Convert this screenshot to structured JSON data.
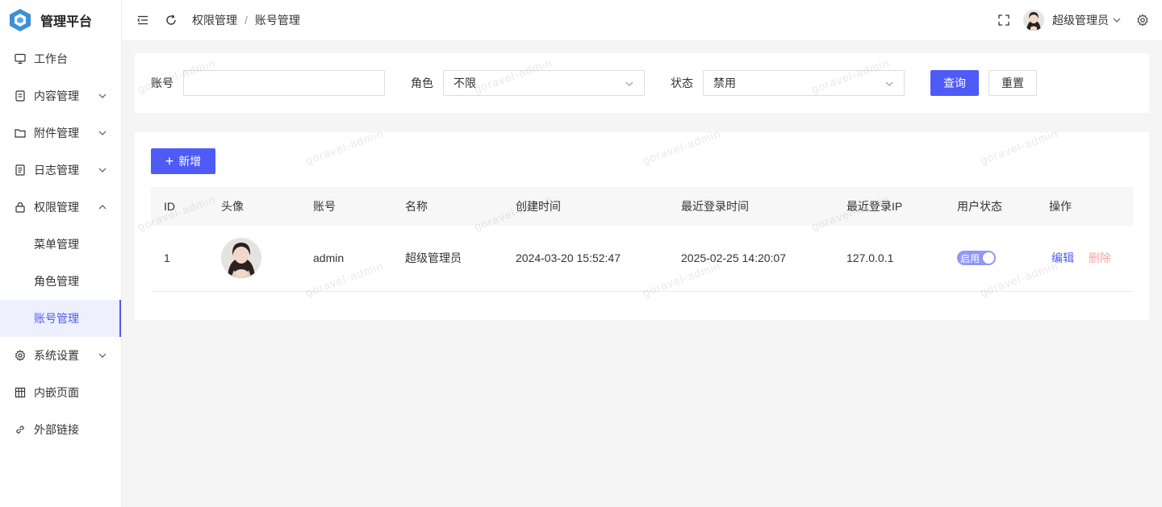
{
  "app": {
    "title": "管理平台"
  },
  "sidebar": {
    "items": [
      {
        "label": "工作台"
      },
      {
        "label": "内容管理"
      },
      {
        "label": "附件管理"
      },
      {
        "label": "日志管理"
      },
      {
        "label": "权限管理"
      },
      {
        "label": "菜单管理"
      },
      {
        "label": "角色管理"
      },
      {
        "label": "账号管理"
      },
      {
        "label": "系统设置"
      },
      {
        "label": "内嵌页面"
      },
      {
        "label": "外部链接"
      }
    ]
  },
  "header": {
    "breadcrumb": [
      "权限管理",
      "账号管理"
    ],
    "separator": "/",
    "username": "超级管理员"
  },
  "search": {
    "account_label": "账号",
    "account_value": "",
    "role_label": "角色",
    "role_value": "不限",
    "status_label": "状态",
    "status_value": "禁用",
    "query_label": "查询",
    "reset_label": "重置"
  },
  "table": {
    "add_label": "新增",
    "columns": [
      "ID",
      "头像",
      "账号",
      "名称",
      "创建时间",
      "最近登录时间",
      "最近登录IP",
      "用户状态",
      "操作"
    ],
    "rows": [
      {
        "id": "1",
        "account": "admin",
        "name": "超级管理员",
        "created": "2024-03-20 15:52:47",
        "last_login": "2025-02-25 14:20:07",
        "last_ip": "127.0.0.1",
        "status_text": "启用",
        "edit_label": "编辑",
        "delete_label": "删除"
      }
    ]
  },
  "watermark": "goravel-admin",
  "colors": {
    "primary": "#4e5bf6",
    "danger_light": "#f0a4a4",
    "switch_on": "#8f97f8"
  }
}
